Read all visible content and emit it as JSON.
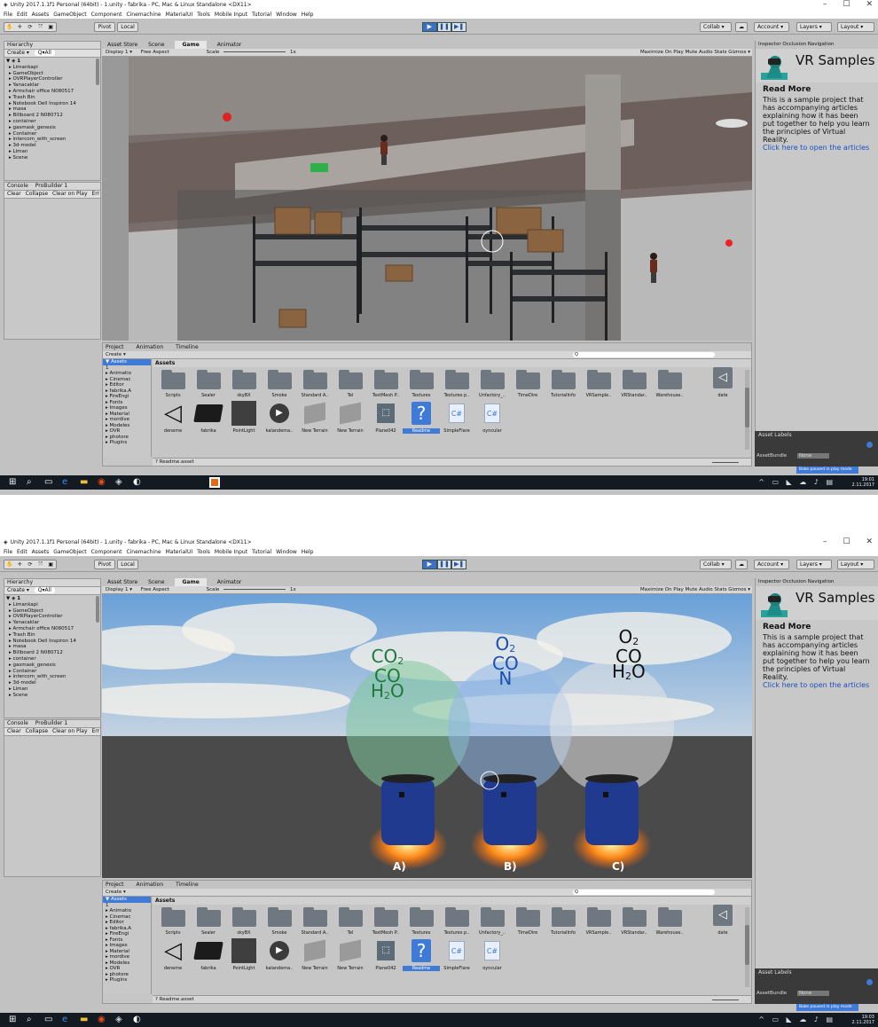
{
  "window": {
    "title": "Unity 2017.1.1f1 Personal (64bit) - 1.unity - fabrika - PC, Mac & Linux Standalone <DX11>",
    "min": "–",
    "max": "☐",
    "close": "✕"
  },
  "menu": [
    "File",
    "Edit",
    "Assets",
    "GameObject",
    "Component",
    "Cinemachine",
    "MaterialUI",
    "Tools",
    "Mobile Input",
    "Tutorial",
    "Window",
    "Help"
  ],
  "toolbar": {
    "pivot": "Pivot",
    "local": "Local",
    "play": "▶",
    "pause": "❚❚",
    "step": "▶❚",
    "collab": "Collab ▾",
    "account": "Account ▾",
    "layers": "Layers ▾",
    "layout": "Layout ▾"
  },
  "hierarchy": {
    "tab": "Hierarchy",
    "create": "Create ▾",
    "search": "Q▾All",
    "scene": "1",
    "items": [
      "Limankapi",
      "GameObject",
      "OVRPlayerController",
      "Yanacaklar",
      "Armchair office N080517",
      "Trash Bin",
      "Notebook Dell Inspiron 14",
      "masa",
      "Billboard 2 N080712",
      "container",
      "gasmask_genesis",
      "Container",
      "intercom_with_screen",
      "3d-model",
      "Liman",
      "Scene"
    ]
  },
  "console": {
    "tab1": "Console",
    "tab2": "ProBuilder 1",
    "clear": "Clear",
    "collapse": "Collapse",
    "clear_on_play": "Clear on Play",
    "err": "Err"
  },
  "game": {
    "tabs": [
      "Asset Store",
      "Scene",
      "Game",
      "Animator"
    ],
    "display": "Display 1 ▾",
    "aspect": "Free Aspect",
    "scale_label": "Scale",
    "scale_val": "1x",
    "options": "Maximize On Play  Mute Audio  Stats  Gizmos ▾"
  },
  "inspector": {
    "tabs": "Inspector  Occlusion  Navigation",
    "title": "VR Samples",
    "read_more": "Read More",
    "body": "This is a sample project that has accompanying articles explaining how it has been put together to help you learn the principles of Virtual Reality.",
    "link": "Click here to open the articles in yo"
  },
  "asset_labels": {
    "title": "Asset Labels",
    "bundle": "AssetBundle",
    "none": "None",
    "bake": "Bake paused in play mode"
  },
  "project": {
    "tabs": [
      "Project",
      "Animation",
      "Timeline"
    ],
    "create": "Create ▾",
    "tree": [
      "Assets",
      "1",
      "Animatio",
      "Cinemac",
      "Editor",
      "fabrika.A",
      "FireEngi",
      "Fonts",
      "Images",
      "Material",
      "mordive",
      "Modeles",
      "OVR",
      "photore",
      "Plugins"
    ],
    "assets_header": "Assets",
    "folders": [
      "Scripts",
      "Sealer",
      "skyBX",
      "Smoke",
      "Standard A..",
      "Tel",
      "TextMesh P..",
      "Textures",
      "Textures p..",
      "Unfactory_..",
      "TimeDire",
      "TutorialInfo",
      "VRSample..",
      "VRStandar..",
      "Warehouse.."
    ],
    "last_folder": "date",
    "items": [
      "deneme",
      "fabrika",
      "PointLight",
      "kalandema..",
      "New Terrain",
      "New Terrain",
      "Plane042",
      "Readme",
      "SimpleFlare",
      "oyncular"
    ],
    "readme_bar": "Readme.asset"
  },
  "taskbar": {
    "time1": "19:01",
    "date1": "2.11.2017",
    "time2": "19:03",
    "date2": "2.11.2017"
  },
  "scene2": {
    "labels": [
      "A)",
      "B)",
      "C)"
    ]
  },
  "colors": {
    "unity_gray": "#c2c2c2",
    "play_blue": "#3f6fc0",
    "link_blue": "#1a50c0",
    "barrel_blue": "#1f3a8f",
    "chem_green": "#1e7a3a",
    "chem_blue": "#1a4fb0",
    "chem_black": "#111111"
  },
  "icons": [
    "unity-logo-icon",
    "hand-tool-icon",
    "move-tool-icon",
    "rotate-tool-icon",
    "scale-tool-icon",
    "rect-tool-icon",
    "cloud-icon",
    "search-icon",
    "windows-start-icon",
    "edge-icon",
    "chrome-icon",
    "folder-icon",
    "csharp-icon"
  ]
}
